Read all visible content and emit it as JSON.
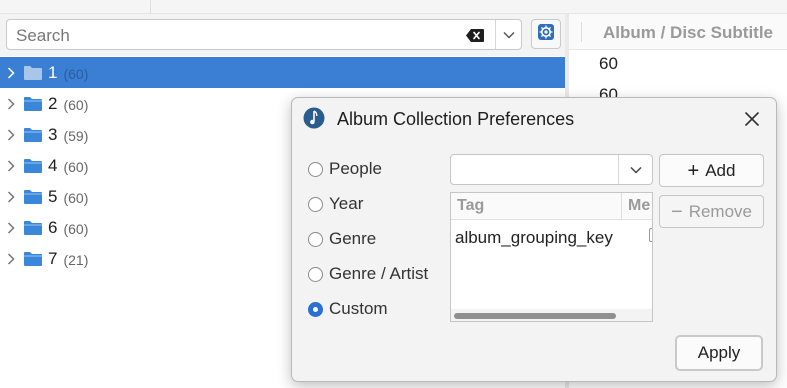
{
  "search": {
    "placeholder": "Search"
  },
  "tree": {
    "items": [
      {
        "label": "1",
        "count": "(60)",
        "selected": true
      },
      {
        "label": "2",
        "count": "(60)"
      },
      {
        "label": "3",
        "count": "(59)"
      },
      {
        "label": "4",
        "count": "(60)"
      },
      {
        "label": "5",
        "count": "(60)"
      },
      {
        "label": "6",
        "count": "(60)"
      },
      {
        "label": "7",
        "count": "(21)"
      }
    ]
  },
  "right_column": {
    "header": "Album / Disc Subtitle",
    "values": [
      "60",
      "60"
    ]
  },
  "dialog": {
    "title": "Album Collection Preferences",
    "radios": [
      {
        "label": "People",
        "checked": false
      },
      {
        "label": "Year",
        "checked": false
      },
      {
        "label": "Genre",
        "checked": false
      },
      {
        "label": "Genre / Artist",
        "checked": false
      },
      {
        "label": "Custom",
        "checked": true
      }
    ],
    "combo_value": "",
    "add_label": "Add",
    "remove_label": "Remove",
    "table": {
      "columns": [
        "Tag",
        "Me"
      ],
      "rows": [
        [
          "album_grouping_key"
        ]
      ]
    },
    "apply_label": "Apply"
  },
  "colors": {
    "selection": "#3b7fd4",
    "radio_checked": "#2b6fd1",
    "folder": "#3a86d8"
  },
  "icons": {
    "expand": "chevron-right-icon",
    "folder": "folder-icon",
    "clear": "clear-search-icon",
    "dropdown": "chevron-down-icon",
    "preferences": "preferences-icon",
    "app": "app-icon",
    "close": "close-icon"
  }
}
